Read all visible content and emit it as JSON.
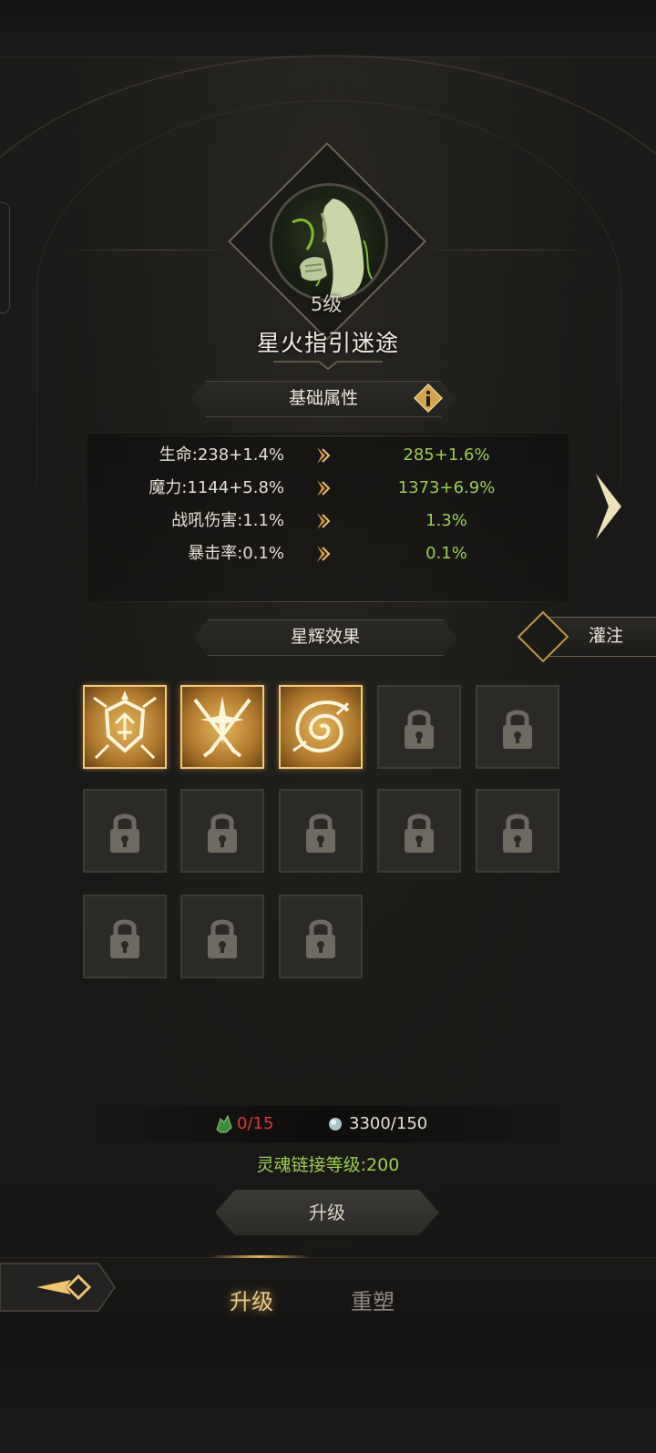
{
  "skill": {
    "level": "5级",
    "name": "星火指引迷途"
  },
  "basic_attributes": {
    "title": "基础属性",
    "rows": [
      {
        "current": "生命:238+1.4%",
        "next": "285+1.6%"
      },
      {
        "current": "魔力:1144+5.8%",
        "next": "1373+6.9%"
      },
      {
        "current": "战吼伤害:1.1%",
        "next": "1.3%"
      },
      {
        "current": "暴击率:0.1%",
        "next": "0.1%"
      }
    ]
  },
  "star_effects": {
    "title": "星辉效果",
    "infuse_label": "灌注",
    "slots": [
      {
        "state": "unlocked",
        "icon": "shield-arrows-icon"
      },
      {
        "state": "unlocked",
        "icon": "crossed-swords-star-icon"
      },
      {
        "state": "unlocked",
        "icon": "spiral-vortex-icon"
      },
      {
        "state": "locked",
        "icon": "lock-icon"
      },
      {
        "state": "locked",
        "icon": "lock-icon"
      },
      {
        "state": "locked",
        "icon": "lock-icon"
      },
      {
        "state": "locked",
        "icon": "lock-icon"
      },
      {
        "state": "locked",
        "icon": "lock-icon"
      },
      {
        "state": "locked",
        "icon": "lock-icon"
      },
      {
        "state": "locked",
        "icon": "lock-icon"
      },
      {
        "state": "locked",
        "icon": "lock-icon"
      },
      {
        "state": "locked",
        "icon": "lock-icon"
      },
      {
        "state": "locked",
        "icon": "lock-icon"
      }
    ]
  },
  "cost": {
    "material_amount": "0/15",
    "material_icon": "green-crystal-icon",
    "currency_amount": "3300/150",
    "currency_icon": "soul-orb-icon"
  },
  "requirement": "灵魂链接等级:200",
  "upgrade_button": "升级",
  "tabs": [
    {
      "label": "升级",
      "active": true
    },
    {
      "label": "重塑",
      "active": false
    }
  ],
  "colors": {
    "accent_gold": "#e8b45a",
    "upgrade_green": "#9bd04a",
    "insufficient_red": "#e0363a"
  }
}
